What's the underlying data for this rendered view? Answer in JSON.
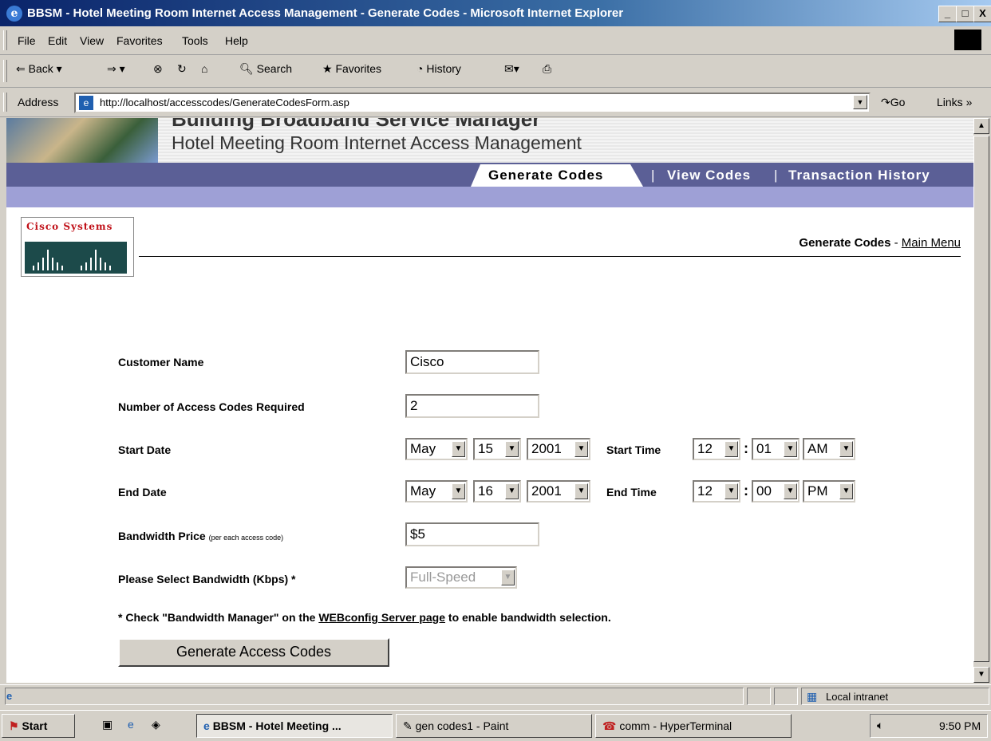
{
  "window": {
    "title": "BBSM - Hotel Meeting Room Internet Access Management - Generate Codes - Microsoft Internet Explorer",
    "minimize": "_",
    "restore": "□",
    "close": "X"
  },
  "menu": [
    "File",
    "Edit",
    "View",
    "Favorites",
    "Tools",
    "Help"
  ],
  "toolbar": {
    "back": "Back",
    "search": "Search",
    "favorites": "Favorites",
    "history": "History"
  },
  "address": {
    "label": "Address",
    "url": "http://localhost/accesscodes/GenerateCodesForm.asp",
    "go": "Go",
    "links": "Links »"
  },
  "banner": {
    "title": "Building Broadband Service Manager",
    "subtitle": "Hotel Meeting Room Internet Access Management"
  },
  "nav": {
    "tabs": [
      "Generate Codes",
      "View Codes",
      "Transaction History"
    ],
    "separator": "|"
  },
  "logo": {
    "text": "Cisco Systems"
  },
  "breadcrumb": {
    "current": "Generate Codes",
    "sep": "-",
    "main_menu": "Main Menu"
  },
  "form": {
    "customer_name": {
      "label": "Customer Name",
      "value": "Cisco"
    },
    "num_codes": {
      "label": "Number of Access Codes Required",
      "value": "2"
    },
    "start_date": {
      "label": "Start Date",
      "month": "May",
      "day": "15",
      "year": "2001"
    },
    "start_time": {
      "label": "Start Time",
      "hour": "12",
      "minute": "01",
      "ampm": "AM"
    },
    "end_date": {
      "label": "End Date",
      "month": "May",
      "day": "16",
      "year": "2001"
    },
    "end_time": {
      "label": "End Time",
      "hour": "12",
      "minute": "00",
      "ampm": "PM"
    },
    "price": {
      "label": "Bandwidth Price",
      "note": "(per each access code)",
      "value": "$5"
    },
    "bandwidth": {
      "label": "Please Select Bandwidth (Kbps) *",
      "value": "Full-Speed"
    },
    "footnote": {
      "pre": "* Check \"Bandwidth Manager\" on the",
      "link": "WEBconfig Server page",
      "post": "to enable bandwidth selection."
    },
    "submit": "Generate Access Codes"
  },
  "status": {
    "zone": "Local intranet"
  },
  "taskbar": {
    "start": "Start",
    "tasks": [
      "BBSM - Hotel Meeting ...",
      "gen codes1 - Paint",
      "comm - HyperTerminal"
    ],
    "clock": "9:50 PM"
  }
}
